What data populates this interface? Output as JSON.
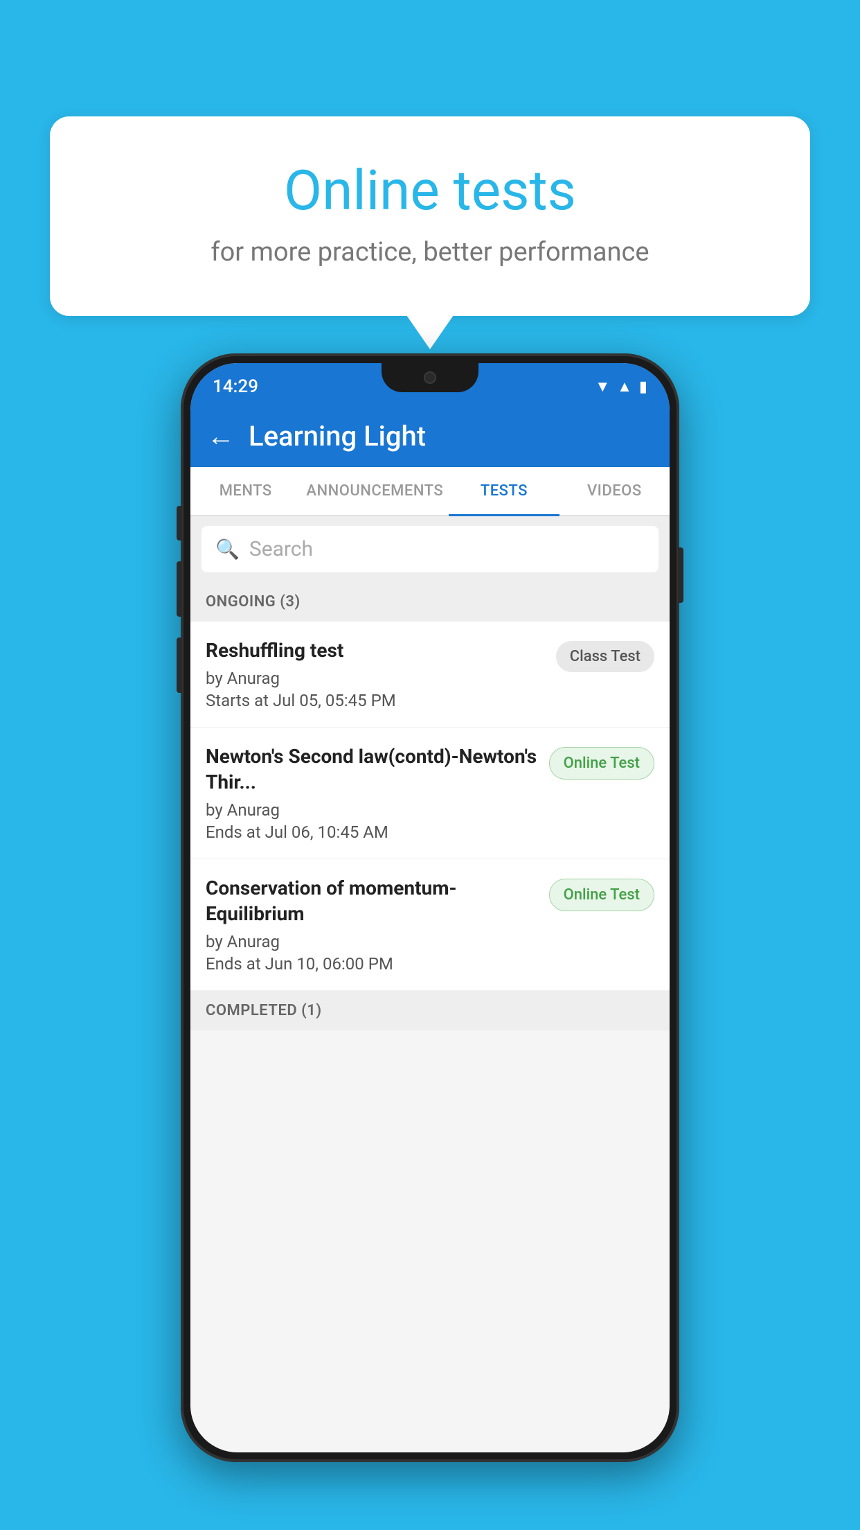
{
  "background_color": "#29b6e8",
  "bubble": {
    "title": "Online tests",
    "subtitle": "for more practice, better performance"
  },
  "phone": {
    "status_bar": {
      "time": "14:29",
      "icons": [
        "wifi",
        "signal",
        "battery"
      ]
    },
    "app_bar": {
      "title": "Learning Light",
      "back_label": "←"
    },
    "tabs": [
      {
        "label": "MENTS",
        "active": false
      },
      {
        "label": "ANNOUNCEMENTS",
        "active": false
      },
      {
        "label": "TESTS",
        "active": true
      },
      {
        "label": "VIDEOS",
        "active": false
      }
    ],
    "search": {
      "placeholder": "Search"
    },
    "ongoing_section": {
      "label": "ONGOING (3)"
    },
    "test_items": [
      {
        "name": "Reshuffling test",
        "author": "by Anurag",
        "date_label": "Starts at",
        "date": "Jul 05, 05:45 PM",
        "badge": "Class Test",
        "badge_type": "class"
      },
      {
        "name": "Newton's Second law(contd)-Newton's Thir...",
        "author": "by Anurag",
        "date_label": "Ends at",
        "date": "Jul 06, 10:45 AM",
        "badge": "Online Test",
        "badge_type": "online"
      },
      {
        "name": "Conservation of momentum-Equilibrium",
        "author": "by Anurag",
        "date_label": "Ends at",
        "date": "Jun 10, 06:00 PM",
        "badge": "Online Test",
        "badge_type": "online"
      }
    ],
    "completed_section": {
      "label": "COMPLETED (1)"
    }
  }
}
